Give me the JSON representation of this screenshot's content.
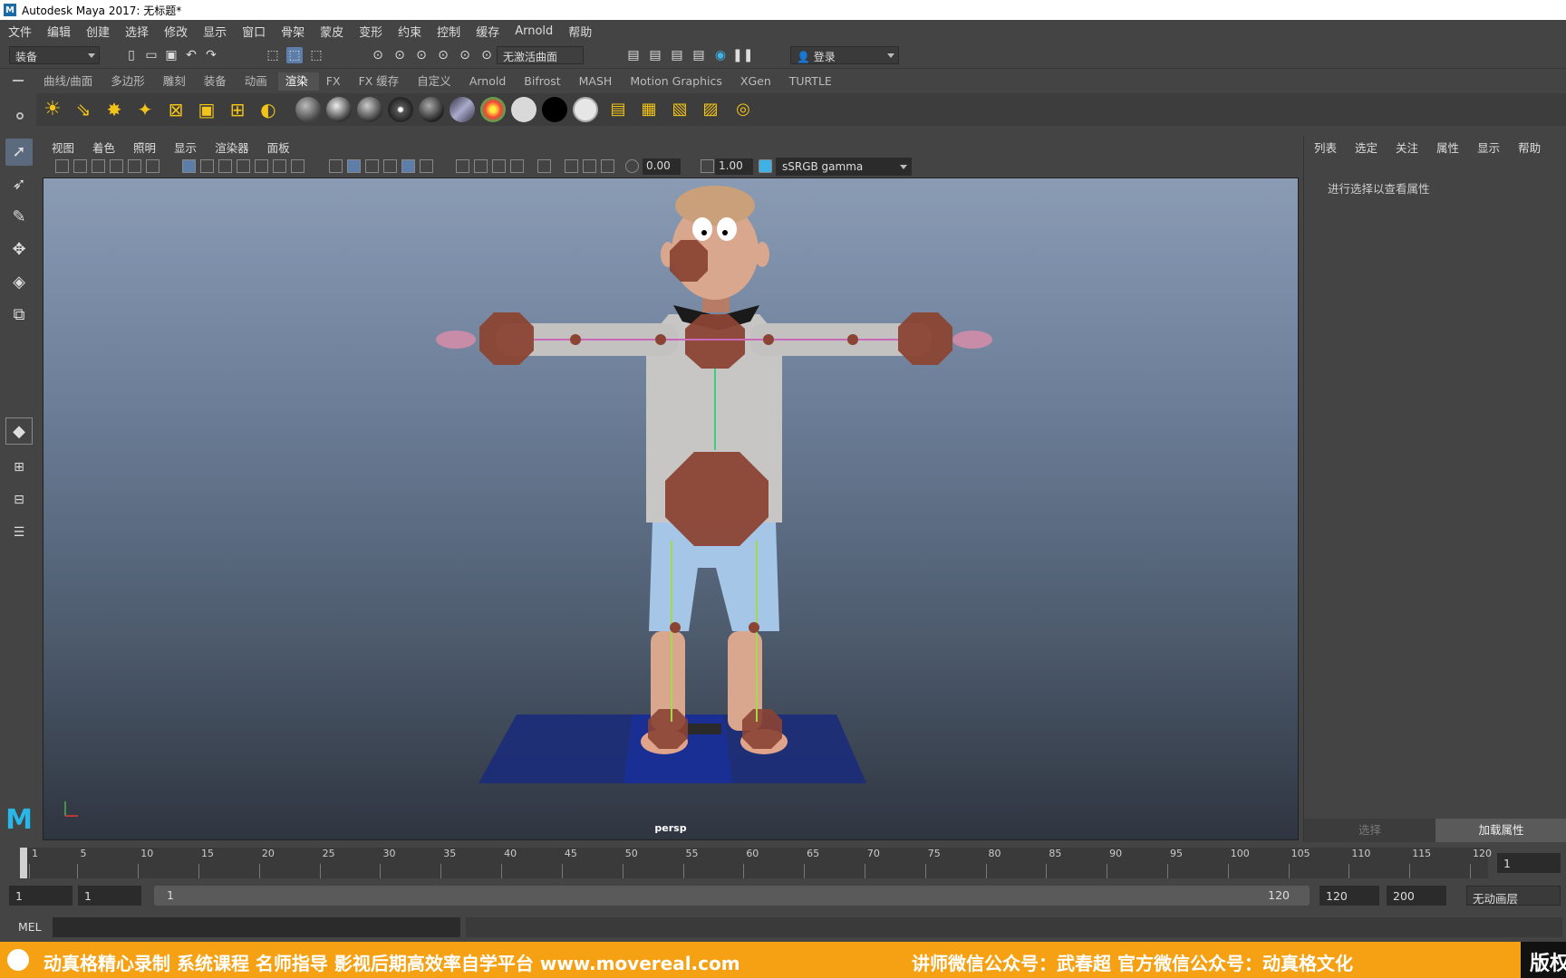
{
  "window": {
    "title": "Autodesk Maya 2017: 无标题*"
  },
  "menu": [
    "文件",
    "编辑",
    "创建",
    "选择",
    "修改",
    "显示",
    "窗口",
    "骨架",
    "蒙皮",
    "变形",
    "约束",
    "控制",
    "缓存",
    "Arnold",
    "帮助"
  ],
  "statusline": {
    "menuset": "装备",
    "live_surface": "无激活曲面",
    "login": "登录"
  },
  "shelf_tabs": [
    "曲线/曲面",
    "多边形",
    "雕刻",
    "装备",
    "动画",
    "渲染",
    "FX",
    "FX 缓存",
    "自定义",
    "Arnold",
    "Bifrost",
    "MASH",
    "Motion Graphics",
    "XGen",
    "TURTLE"
  ],
  "shelf_active_tab": "渲染",
  "viewport": {
    "menu": [
      "视图",
      "着色",
      "照明",
      "显示",
      "渲染器",
      "面板"
    ],
    "exposure": "0.00",
    "gamma": "1.00",
    "color_space": "sSRGB gamma",
    "camera": "persp"
  },
  "attribute_panel": {
    "menu": [
      "列表",
      "选定",
      "关注",
      "属性",
      "显示",
      "帮助"
    ],
    "hint": "进行选择以查看属性",
    "buttons": [
      "选择",
      "加载属性"
    ]
  },
  "timeline": {
    "ticks": [
      "1",
      "5",
      "10",
      "15",
      "20",
      "25",
      "30",
      "35",
      "40",
      "45",
      "50",
      "55",
      "60",
      "65",
      "70",
      "75",
      "80",
      "85",
      "90",
      "95",
      "100",
      "105",
      "110",
      "115",
      "120"
    ],
    "current_frame": "1"
  },
  "range": {
    "start": "1",
    "playback_start": "1",
    "slider_start": "1",
    "slider_end": "120",
    "playback_end": "120",
    "end": "200",
    "anim_layer": "无动画层"
  },
  "cmdline": {
    "label": "MEL"
  },
  "banner": {
    "left": "动真格精心录制 系统课程 名师指导 影视后期高效率自学平台 www.movereal.com",
    "right": "讲师微信公众号：武春超    官方微信公众号：动真格文化",
    "corner": "版权"
  }
}
